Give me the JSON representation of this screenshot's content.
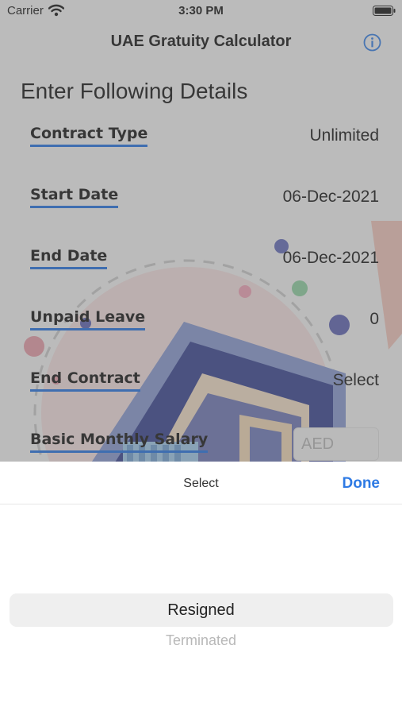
{
  "status_bar": {
    "carrier": "Carrier",
    "time": "3:30 PM"
  },
  "nav": {
    "title": "UAE Gratuity Calculator"
  },
  "form": {
    "heading": "Enter Following Details",
    "rows": [
      {
        "label": "Contract Type",
        "value": "Unlimited"
      },
      {
        "label": "Start Date",
        "value": "06-Dec-2021"
      },
      {
        "label": "End Date",
        "value": "06-Dec-2021"
      },
      {
        "label": "Unpaid Leave",
        "value": "0"
      },
      {
        "label": "End Contract",
        "value": "Select"
      },
      {
        "label": "Basic Monthly Salary",
        "placeholder": "AED"
      }
    ]
  },
  "picker": {
    "title": "Select",
    "done_label": "Done",
    "options": [
      "Resigned",
      "Terminated"
    ],
    "selected_index": 0
  },
  "colors": {
    "accent": "#2e7ae4",
    "underline": "#1e6fe0"
  }
}
